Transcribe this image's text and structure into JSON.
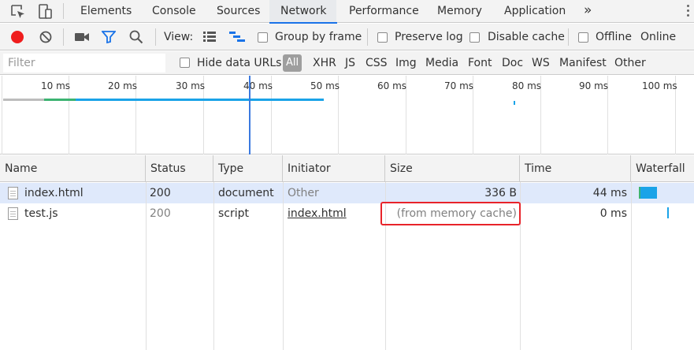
{
  "tabs": [
    {
      "label": "Elements"
    },
    {
      "label": "Console"
    },
    {
      "label": "Sources"
    },
    {
      "label": "Network",
      "active": true
    },
    {
      "label": "Performance"
    },
    {
      "label": "Memory"
    },
    {
      "label": "Application"
    }
  ],
  "more_tabs": "»",
  "toolbar": {
    "view_label": "View:",
    "group_by_frame": "Group by frame",
    "preserve_log": "Preserve log",
    "disable_cache": "Disable cache",
    "offline": "Offline",
    "throttle": "Online"
  },
  "filterbar": {
    "placeholder": "Filter",
    "hide_data_urls": "Hide data URLs",
    "types": [
      "All",
      "XHR",
      "JS",
      "CSS",
      "Img",
      "Media",
      "Font",
      "Doc",
      "WS",
      "Manifest",
      "Other"
    ]
  },
  "overview": {
    "ticks": [
      "10 ms",
      "20 ms",
      "30 ms",
      "40 ms",
      "50 ms",
      "60 ms",
      "70 ms",
      "80 ms",
      "90 ms",
      "100 ms"
    ]
  },
  "table": {
    "columns": [
      "Name",
      "Status",
      "Type",
      "Initiator",
      "Size",
      "Time",
      "Waterfall"
    ],
    "rows": [
      {
        "name": "index.html",
        "status": "200",
        "type": "document",
        "initiator": "Other",
        "size": "336 B",
        "time": "44 ms"
      },
      {
        "name": "test.js",
        "status": "200",
        "type": "script",
        "initiator": "index.html",
        "size": "(from memory cache)",
        "time": "0 ms"
      }
    ]
  },
  "colors": {
    "accent": "#1a73e8",
    "record": "#ef1d1d",
    "highlight": "#e8232a",
    "waterfall": "#1aa3e8"
  }
}
